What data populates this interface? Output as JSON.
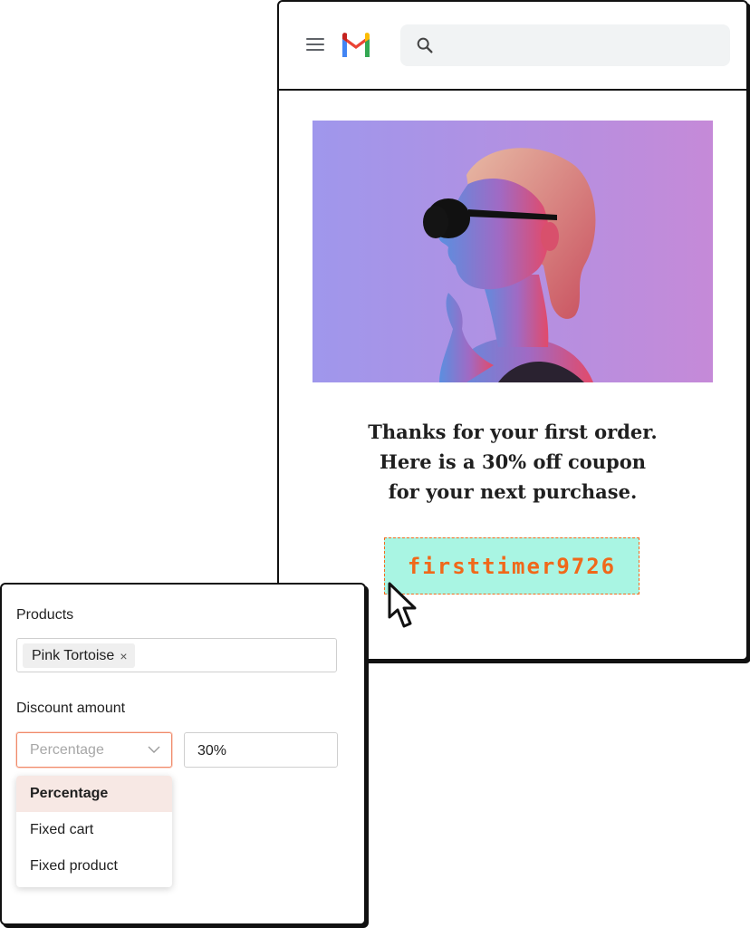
{
  "email": {
    "search": {
      "placeholder": "",
      "value": ""
    },
    "message_lines": [
      "Thanks for your first order.",
      "Here is a 30% off coupon",
      "for your next purchase."
    ],
    "coupon_code": "firsttimer9726",
    "colors": {
      "coupon_text": "#f0681a",
      "coupon_bg": "#a9f5e3",
      "coupon_border": "#f26b1d",
      "hero_gradient_left": "#9f97ec",
      "hero_gradient_right": "#c58ad8"
    },
    "icons": {
      "menu": "hamburger-menu-icon",
      "logo": "gmail-logo",
      "search": "magnifier-search-icon"
    }
  },
  "form": {
    "products_label": "Products",
    "product_chips": [
      {
        "label": "Pink Tortoise",
        "remove": "×"
      }
    ],
    "discount_label": "Discount amount",
    "discount_type": {
      "placeholder": "Percentage",
      "options": [
        "Percentage",
        "Fixed cart",
        "Fixed product"
      ],
      "highlighted": "Percentage"
    },
    "amount_value": "30%",
    "colors": {
      "select_focus_border": "#f08a6a",
      "highlighted_option_bg": "#f7e8e4"
    }
  }
}
